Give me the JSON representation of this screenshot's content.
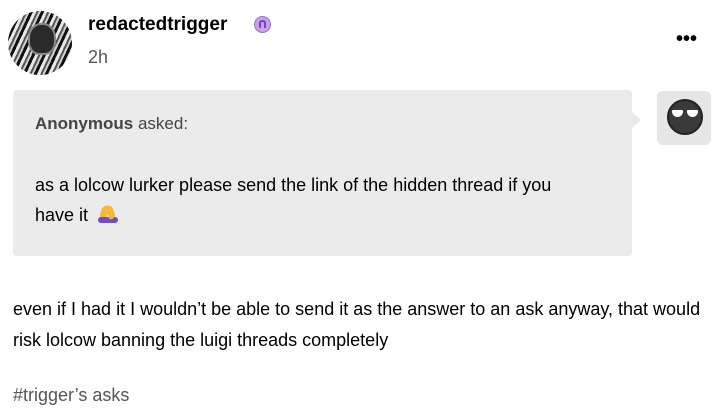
{
  "post": {
    "username": "redactedtrigger",
    "badge_icon": "ghost-badge-icon",
    "timestamp": "2h",
    "more_label": "•••"
  },
  "ask": {
    "asker_name": "Anonymous",
    "asker_suffix": " asked:",
    "question": "as a lolcow lurker please send the link of the hidden thread if you have it",
    "question_emoji": "folded-hands-icon",
    "bubble_color": "#ebebeb"
  },
  "answer": {
    "text": "even if I had it I wouldn’t be able to send it as the answer to an ask anyway, that would risk lolcow banning the luigi threads completely"
  },
  "tags": [
    "#trigger’s asks"
  ]
}
